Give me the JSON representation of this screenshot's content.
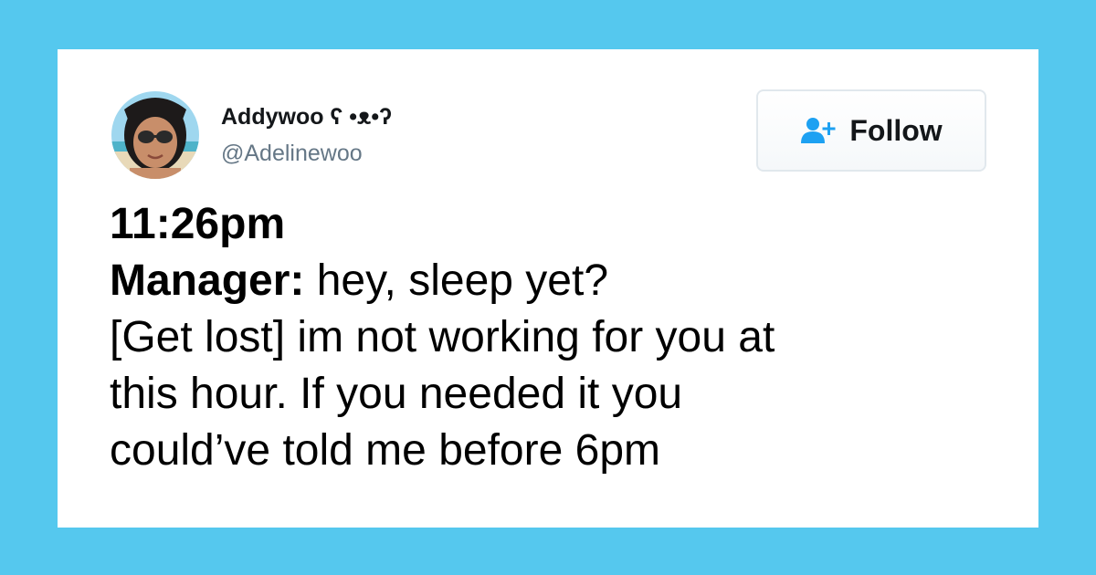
{
  "colors": {
    "page_background": "#55c8ee",
    "card_background": "#ffffff",
    "name_color": "#14171a",
    "handle_color": "#657786",
    "follow_icon_color": "#1da1f2",
    "button_border": "#e1e8ed"
  },
  "profile": {
    "avatar_icon": "user-photo-avatar",
    "display_name": "Addywoo ʕ •ᴥ•ʔ",
    "handle": "@Adelinewoo"
  },
  "follow_button": {
    "icon": "add-user-icon",
    "label": "Follow"
  },
  "tweet": {
    "time": "11:26pm",
    "speaker": "Manager:",
    "quote": " hey, sleep yet?",
    "line3": "[Get lost] im not working for you at",
    "line4": "this hour. If you needed it you",
    "line5": "could’ve told me before 6pm"
  }
}
